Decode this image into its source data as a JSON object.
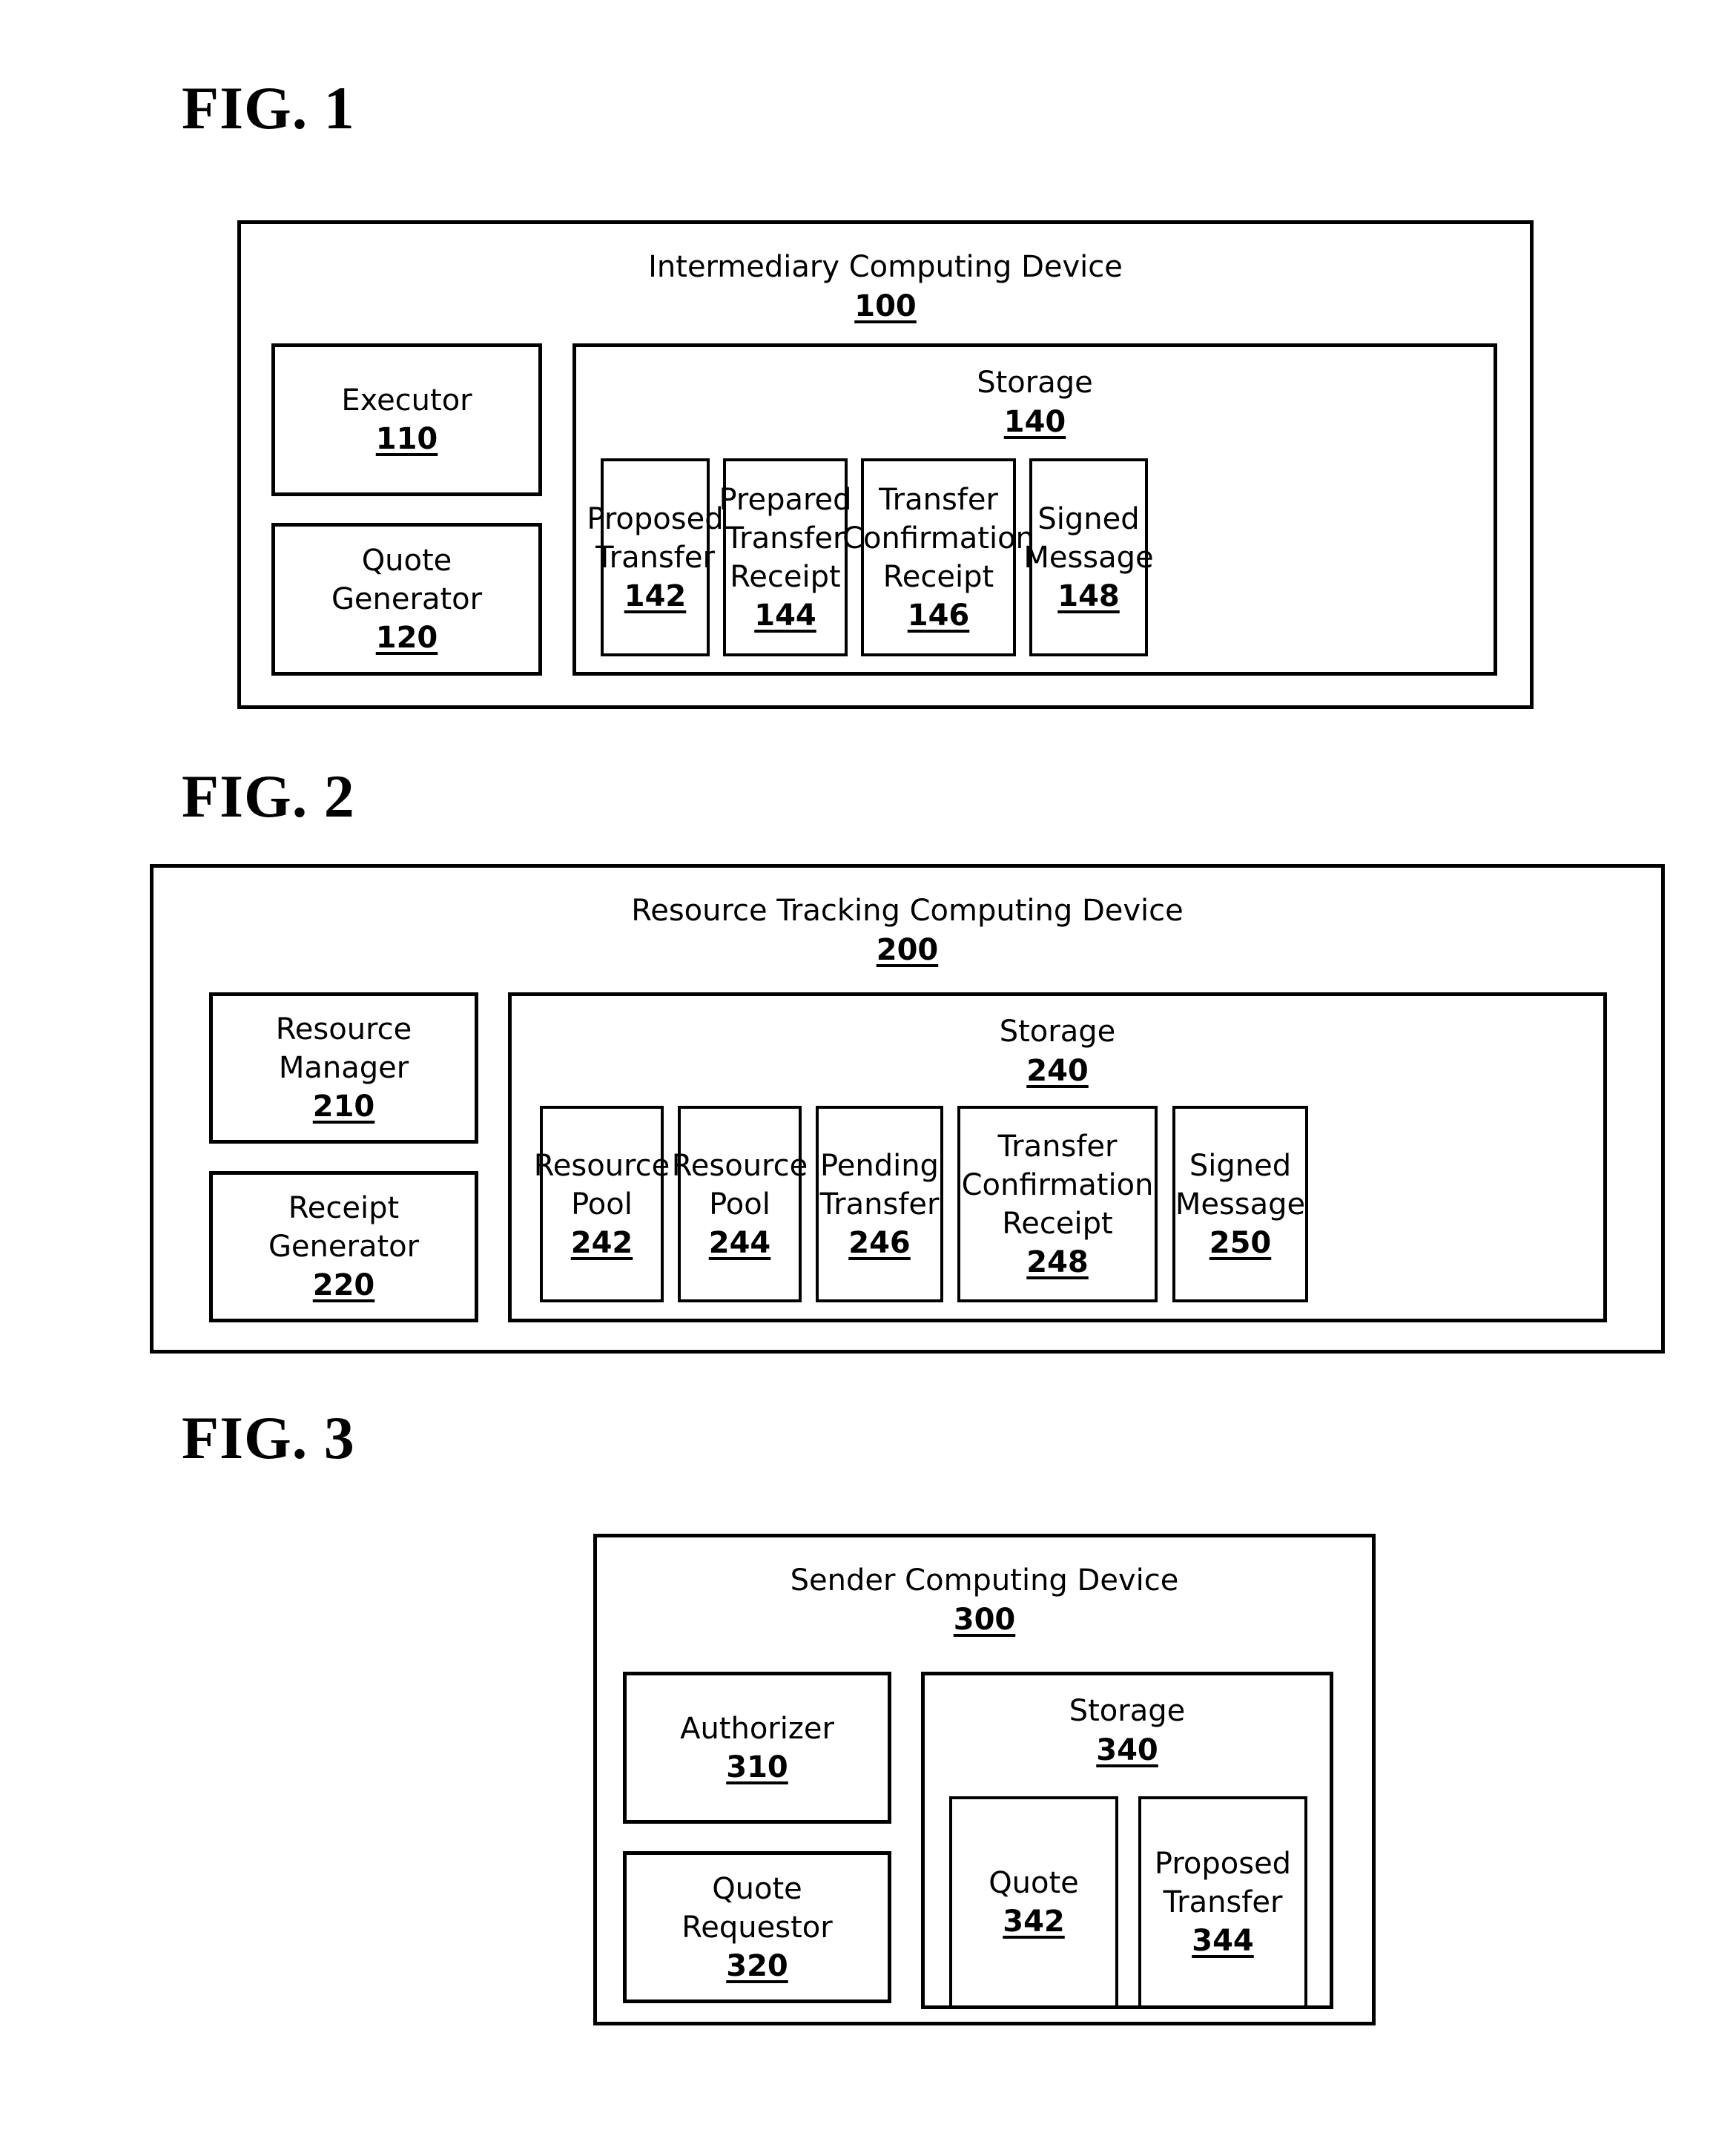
{
  "figures": [
    {
      "label": "FIG. 1",
      "device": {
        "title": "Intermediary Computing Device",
        "ref": "100"
      },
      "components": [
        {
          "title": "Executor",
          "ref": "110"
        },
        {
          "title": "Quote\nGenerator",
          "ref": "120"
        }
      ],
      "storage": {
        "title": "Storage",
        "ref": "140"
      },
      "storage_items": [
        {
          "title": "Proposed\nTransfer",
          "ref": "142"
        },
        {
          "title": "Prepared\nTransfer\nReceipt",
          "ref": "144"
        },
        {
          "title": "Transfer\nConfirmation\nReceipt",
          "ref": "146"
        },
        {
          "title": "Signed\nMessage",
          "ref": "148"
        }
      ]
    },
    {
      "label": "FIG. 2",
      "device": {
        "title": "Resource Tracking Computing Device",
        "ref": "200"
      },
      "components": [
        {
          "title": "Resource\nManager",
          "ref": "210"
        },
        {
          "title": "Receipt\nGenerator",
          "ref": "220"
        }
      ],
      "storage": {
        "title": "Storage",
        "ref": "240"
      },
      "storage_items": [
        {
          "title": "Resource\nPool",
          "ref": "242"
        },
        {
          "title": "Resource\nPool",
          "ref": "244"
        },
        {
          "title": "Pending\nTransfer",
          "ref": "246"
        },
        {
          "title": "Transfer\nConfirmation\nReceipt",
          "ref": "248"
        },
        {
          "title": "Signed\nMessage",
          "ref": "250"
        }
      ]
    },
    {
      "label": "FIG. 3",
      "device": {
        "title": "Sender Computing Device",
        "ref": "300"
      },
      "components": [
        {
          "title": "Authorizer",
          "ref": "310"
        },
        {
          "title": "Quote\nRequestor",
          "ref": "320"
        }
      ],
      "storage": {
        "title": "Storage",
        "ref": "340"
      },
      "storage_items": [
        {
          "title": "Quote",
          "ref": "342"
        },
        {
          "title": "Proposed\nTransfer",
          "ref": "344"
        }
      ]
    }
  ],
  "colors": {
    "ink": "#000000",
    "paper": "#ffffff"
  }
}
